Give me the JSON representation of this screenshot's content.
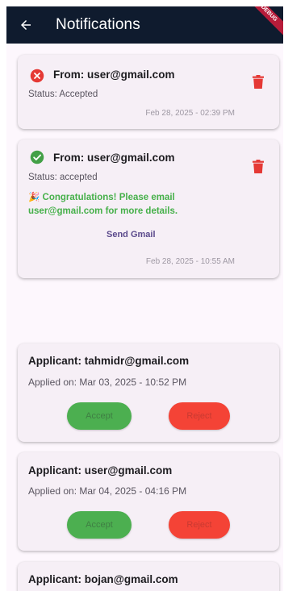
{
  "appbar": {
    "title": "Notifications",
    "debug_banner": "DEBUG",
    "color": "#0f1b2e"
  },
  "notifications": [
    {
      "icon": "cancel-icon",
      "icon_color": "#e53935",
      "from": "From: user@gmail.com",
      "status": "Status: Accepted",
      "time": "Feb 28, 2025 - 02:39 PM"
    },
    {
      "icon": "check-circle-icon",
      "icon_color": "#43a047",
      "from": "From: user@gmail.com",
      "status": "Status: accepted",
      "message": "🎉 Congratulations! Please email user@gmail.com for more details.",
      "action": "Send Gmail",
      "time": "Feb 28, 2025 - 10:55 AM"
    }
  ],
  "applications": [
    {
      "applicant": "Applicant: tahmidr@gmail.com",
      "applied_on": "Applied on: Mar 03, 2025 - 10:52 PM",
      "accept_label": "Accept",
      "reject_label": "Reject"
    },
    {
      "applicant": "Applicant: user@gmail.com",
      "applied_on": "Applied on: Mar 04, 2025 - 04:16 PM",
      "accept_label": "Accept",
      "reject_label": "Reject"
    },
    {
      "applicant": "Applicant: bojan@gmail.com"
    }
  ],
  "colors": {
    "accept": "#4caf50",
    "reject": "#f44336",
    "delete": "#e53935",
    "congrats_text": "#46b04a"
  }
}
